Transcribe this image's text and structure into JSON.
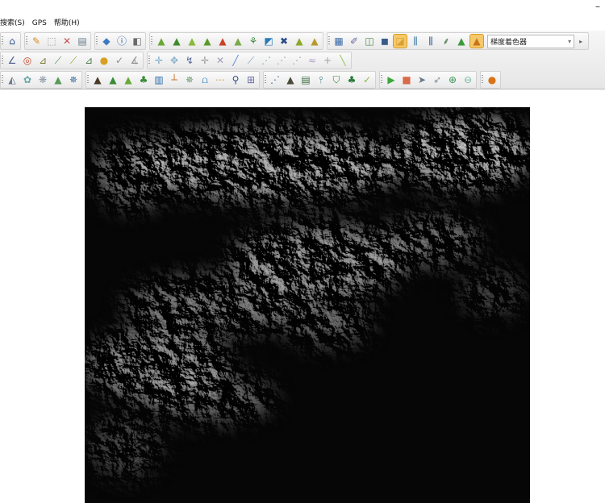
{
  "window": {
    "minimize_label": "–"
  },
  "menubar": {
    "items": [
      "搜索(S)",
      "GPS",
      "帮助(H)"
    ]
  },
  "toolbar": {
    "rows": [
      {
        "groups": [
          {
            "icons": [
              {
                "name": "home-icon",
                "glyph": "⌂",
                "color": "#2c4f8c"
              }
            ]
          },
          {
            "icons": [
              {
                "name": "pencil-icon",
                "glyph": "✎",
                "color": "#d98a1a"
              },
              {
                "name": "select-box-icon",
                "glyph": "⬚",
                "color": "#9a9a9a"
              },
              {
                "name": "delete-icon",
                "glyph": "✕",
                "color": "#c05050"
              },
              {
                "name": "list-icon",
                "glyph": "▤",
                "color": "#6c7a8a"
              }
            ]
          },
          {
            "icons": [
              {
                "name": "tag-icon",
                "glyph": "◆",
                "color": "#3a78c2"
              },
              {
                "name": "info-icon",
                "glyph": "ⓘ",
                "color": "#2a5da8"
              },
              {
                "name": "zoom-layer-icon",
                "glyph": "◧",
                "color": "#6a6a6a"
              }
            ]
          },
          {
            "icons": [
              {
                "name": "terrain-1-icon",
                "glyph": "▲",
                "color": "#6aa83a"
              },
              {
                "name": "terrain-2-icon",
                "glyph": "▲",
                "color": "#3f8a2a"
              },
              {
                "name": "terrain-3-icon",
                "glyph": "▲",
                "color": "#8ab83a"
              },
              {
                "name": "terrain-4-icon",
                "glyph": "▲",
                "color": "#5a9a2a"
              },
              {
                "name": "terrain-5-icon",
                "glyph": "▲",
                "color": "#c8442a"
              },
              {
                "name": "terrain-6-icon",
                "glyph": "▲",
                "color": "#7aa84a"
              },
              {
                "name": "terrain-7-icon",
                "glyph": "⚘",
                "color": "#3f8a4a"
              },
              {
                "name": "terrain-8-icon",
                "glyph": "◩",
                "color": "#2a7ab8"
              },
              {
                "name": "terrain-9-icon",
                "glyph": "✖",
                "color": "#2a4a8a"
              },
              {
                "name": "terrain-10-icon",
                "glyph": "▲",
                "color": "#8aa82a"
              },
              {
                "name": "terrain-11-icon",
                "glyph": "▲",
                "color": "#b89a2a"
              }
            ]
          },
          {
            "icons": [
              {
                "name": "table-icon",
                "glyph": "▦",
                "color": "#3a6aa8"
              },
              {
                "name": "brush-icon",
                "glyph": "✐",
                "color": "#6a6a9a"
              },
              {
                "name": "align-icon",
                "glyph": "◫",
                "color": "#4a8a4a"
              },
              {
                "name": "cube-icon",
                "glyph": "◼",
                "color": "#3a5a8a"
              },
              {
                "name": "slope-icon",
                "glyph": "◪",
                "color": "#d8a030",
                "active": true
              },
              {
                "name": "bars-1-icon",
                "glyph": "⫼",
                "color": "#3a7aa8"
              },
              {
                "name": "bars-2-icon",
                "glyph": "⫼",
                "color": "#2a5a8a"
              },
              {
                "name": "tree-icon",
                "glyph": "⸙",
                "color": "#3a6a3a"
              },
              {
                "name": "mountain-color-icon",
                "glyph": "▲",
                "color": "#3a9a3a"
              },
              {
                "name": "gradient-shader-icon",
                "glyph": "▲",
                "color": "#c8741a",
                "active": true
              }
            ],
            "combo": true
          }
        ]
      },
      {
        "groups": [
          {
            "icons": [
              {
                "name": "angle-icon",
                "glyph": "∠",
                "color": "#4a5a8a"
              },
              {
                "name": "target-icon",
                "glyph": "◎",
                "color": "#c84a2a"
              },
              {
                "name": "ruler-icon",
                "glyph": "⊿",
                "color": "#7a7a2a"
              },
              {
                "name": "slope-line-icon",
                "glyph": "⟋",
                "color": "#4a8a4a"
              },
              {
                "name": "slope-2-icon",
                "glyph": "⟋",
                "color": "#8aa82a"
              },
              {
                "name": "slope-3-icon",
                "glyph": "⊿",
                "color": "#4a7a4a"
              },
              {
                "name": "blob-icon",
                "glyph": "●",
                "color": "#d8a020"
              },
              {
                "name": "check-icon",
                "glyph": "✓",
                "color": "#8a8a8a"
              },
              {
                "name": "edit-angle-icon",
                "glyph": "∡",
                "color": "#8a8a8a"
              }
            ]
          },
          {
            "icons": [
              {
                "name": "move-1-icon",
                "glyph": "✛",
                "color": "#7aa8c8"
              },
              {
                "name": "move-2-icon",
                "glyph": "✥",
                "color": "#8ab0c8"
              },
              {
                "name": "curve-icon",
                "glyph": "↯",
                "color": "#5a6a9a"
              },
              {
                "name": "move-3-icon",
                "glyph": "✛",
                "color": "#9a9a9a"
              },
              {
                "name": "cross-icon",
                "glyph": "✕",
                "color": "#a0a0c0"
              },
              {
                "name": "line-1-icon",
                "glyph": "╱",
                "color": "#5a8ac8"
              },
              {
                "name": "line-2-icon",
                "glyph": "⟋",
                "color": "#7aa0c8"
              },
              {
                "name": "line-3-icon",
                "glyph": "⋰",
                "color": "#8aa8a8"
              },
              {
                "name": "line-4-icon",
                "glyph": "⋰",
                "color": "#9aa8b8"
              },
              {
                "name": "line-5-icon",
                "glyph": "⋰",
                "color": "#a0a0c0"
              },
              {
                "name": "line-6-icon",
                "glyph": "≈",
                "color": "#b0a0c8"
              },
              {
                "name": "plus-icon",
                "glyph": "+",
                "color": "#a0a0a0"
              },
              {
                "name": "line-7-icon",
                "glyph": "╲",
                "color": "#8ac84a"
              }
            ]
          }
        ]
      },
      {
        "groups": [
          {
            "icons": [
              {
                "name": "tool-1-icon",
                "glyph": "◭",
                "color": "#6a7a8a"
              },
              {
                "name": "tool-2-icon",
                "glyph": "✿",
                "color": "#6aa8a8"
              },
              {
                "name": "tool-3-icon",
                "glyph": "❋",
                "color": "#8a9aa8"
              },
              {
                "name": "tool-4-icon",
                "glyph": "▲",
                "color": "#5a9a5a"
              },
              {
                "name": "tool-5-icon",
                "glyph": "✵",
                "color": "#3a6a9a"
              }
            ]
          },
          {
            "icons": [
              {
                "name": "mountain-1-icon",
                "glyph": "▲",
                "color": "#4a3a2a"
              },
              {
                "name": "river-1-icon",
                "glyph": "▲",
                "color": "#3a8a3a"
              },
              {
                "name": "river-2-icon",
                "glyph": "▲",
                "color": "#6aa83a"
              },
              {
                "name": "tree-2-icon",
                "glyph": "♣",
                "color": "#3a8a3a"
              },
              {
                "name": "building-icon",
                "glyph": "▥",
                "color": "#2a6aa8"
              },
              {
                "name": "pole-icon",
                "glyph": "┴",
                "color": "#c8742a"
              },
              {
                "name": "pole-2-icon",
                "glyph": "✵",
                "color": "#6a9a6a"
              },
              {
                "name": "water-icon",
                "glyph": "⩍",
                "color": "#3a8ac8"
              },
              {
                "name": "dots-icon",
                "glyph": "⋯",
                "color": "#c8a02a"
              },
              {
                "name": "key-icon",
                "glyph": "⚲",
                "color": "#2a4a8a"
              },
              {
                "name": "grid-icon",
                "glyph": "⊞",
                "color": "#6a6aa8"
              }
            ]
          },
          {
            "icons": [
              {
                "name": "point-1-icon",
                "glyph": "⋰",
                "color": "#3a6a9a"
              },
              {
                "name": "peak-icon",
                "glyph": "▲",
                "color": "#4a4a3a"
              },
              {
                "name": "layer-1-icon",
                "glyph": "▤",
                "color": "#3a6a3a"
              },
              {
                "name": "layer-2-icon",
                "glyph": "⫯",
                "color": "#4a8a8a"
              },
              {
                "name": "shield-icon",
                "glyph": "⛉",
                "color": "#3a8a3a"
              },
              {
                "name": "tree-3-icon",
                "glyph": "♣",
                "color": "#2a7a3a"
              },
              {
                "name": "paint-icon",
                "glyph": "✓",
                "color": "#8ab84a"
              }
            ]
          },
          {
            "icons": [
              {
                "name": "play-icon",
                "glyph": "▶",
                "color": "#3aa83a"
              },
              {
                "name": "stop-icon",
                "glyph": "■",
                "color": "#d86a4a"
              },
              {
                "name": "fly-icon",
                "glyph": "➤",
                "color": "#6a7a8a"
              },
              {
                "name": "fly-2-icon",
                "glyph": "➶",
                "color": "#7a8a9a"
              },
              {
                "name": "zoom-in-icon",
                "glyph": "⊕",
                "color": "#3a9a5a"
              },
              {
                "name": "zoom-out-icon",
                "glyph": "⊖",
                "color": "#7ab89a"
              }
            ]
          },
          {
            "icons": [
              {
                "name": "globe-icon",
                "glyph": "●",
                "color": "#d8741a"
              }
            ]
          }
        ]
      }
    ],
    "combo_label": "梯度着色器",
    "combo_arrow": "▾",
    "combo_sep": "▸"
  },
  "map": {
    "canvas_bg": "#060606",
    "frame_bg": "#ffffff"
  }
}
